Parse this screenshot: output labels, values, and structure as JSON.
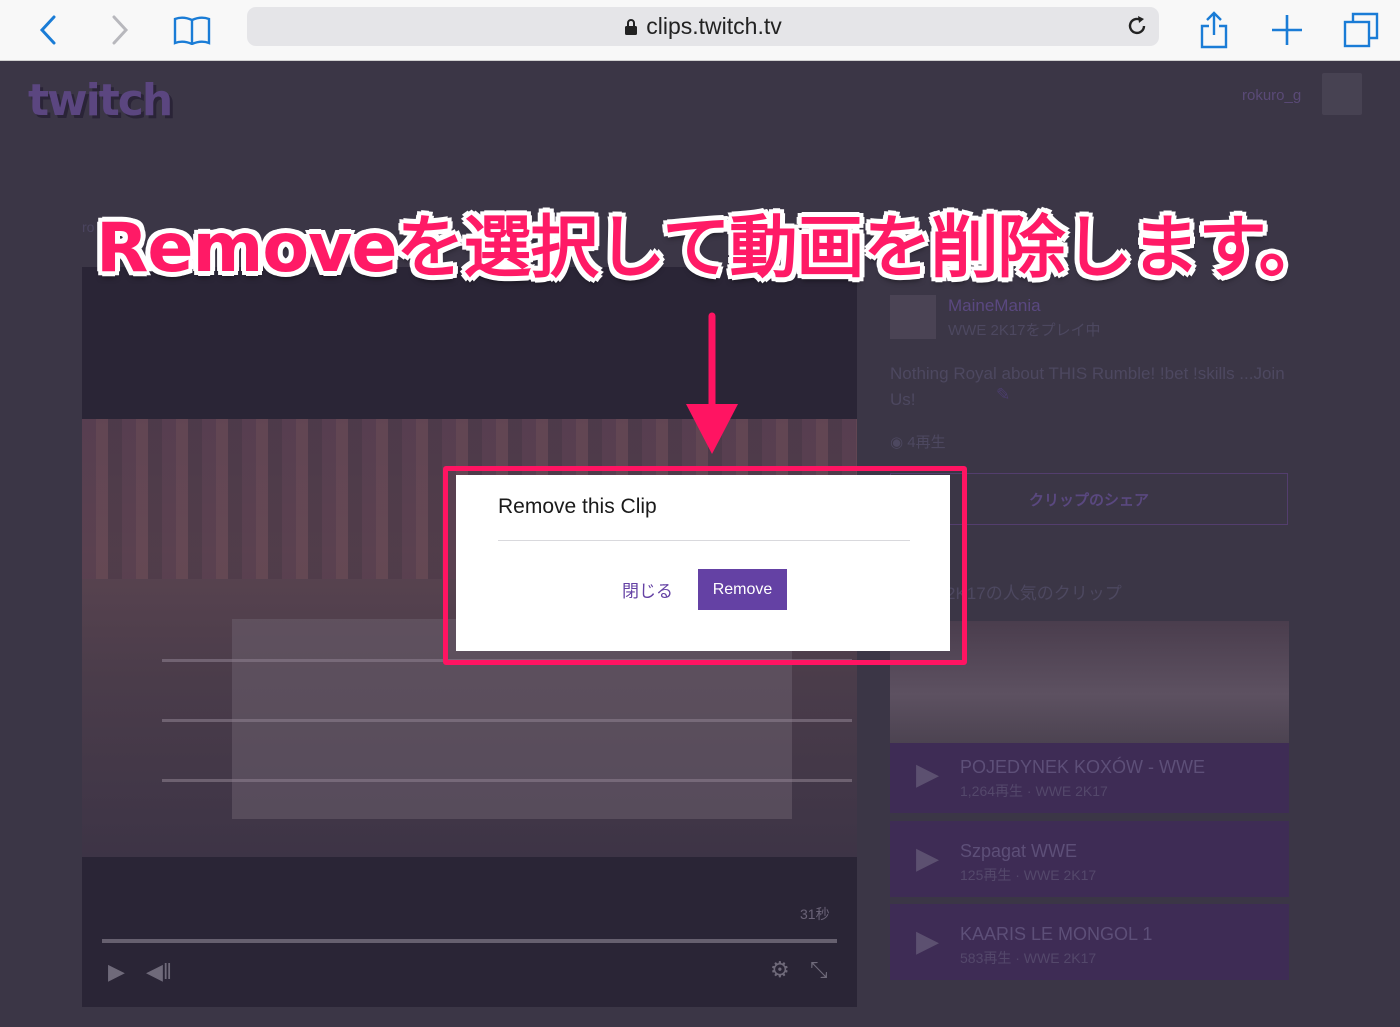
{
  "browser": {
    "url": "clips.twitch.tv"
  },
  "header": {
    "logo": "twitch",
    "username": "rokuro_g"
  },
  "page": {
    "ro_text": "ro"
  },
  "player": {
    "duration": "31秒"
  },
  "sidebar": {
    "channel_name": "MaineMania",
    "channel_game": "WWE 2K17をプレイ中",
    "clip_title": "Nothing Royal about THIS Rumble! !bet !skills ...Join Us!",
    "views": "4再生",
    "share_label": "クリップのシェア",
    "popular_heading": "2K17の人気のクリップ",
    "clips": [
      {
        "title": "POJEDYNEK KOXÓW - WWE",
        "meta": "1,264再生 · WWE 2K17"
      },
      {
        "title": "Szpagat WWE",
        "meta": "125再生 · WWE 2K17"
      },
      {
        "title": "KAARIS LE MONGOL 1",
        "meta": "583再生 · WWE 2K17"
      }
    ]
  },
  "modal": {
    "title": "Remove this Clip",
    "close_label": "閉じる",
    "remove_label": "Remove"
  },
  "annotation": {
    "text": "Removeを選択して動画を削除します。",
    "color": "#ff1462"
  },
  "colors": {
    "accent": "#6441a4",
    "highlight": "#ff1462"
  }
}
